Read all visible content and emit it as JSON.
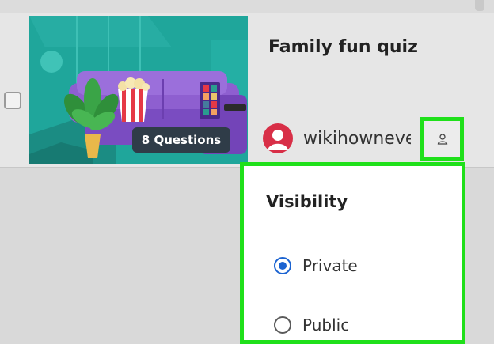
{
  "quiz_card": {
    "title": "Family fun quiz",
    "question_badge": "8 Questions",
    "owner_name": "wikihownever",
    "thumbnail_icon": "living-room-illustration"
  },
  "visibility_menu": {
    "title": "Visibility",
    "options": [
      {
        "label": "Private",
        "selected": true
      },
      {
        "label": "Public",
        "selected": false
      }
    ]
  },
  "colors": {
    "highlight": "#1fe01a",
    "radio_selected": "#1b63d1",
    "avatar": "#d82f47",
    "thumbnail_bg": "#1fa69b",
    "sofa": "#8e5fd0"
  }
}
